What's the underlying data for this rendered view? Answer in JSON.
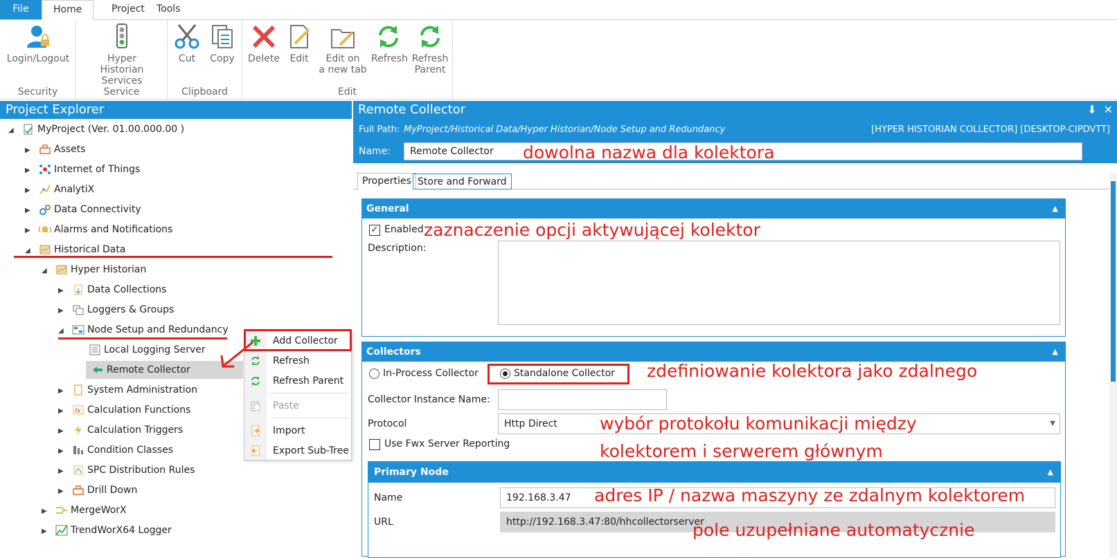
{
  "ribbon": {
    "tabs": {
      "file": "File",
      "home": "Home",
      "project": "Project",
      "tools": "Tools"
    },
    "groups": {
      "security": {
        "label": "Security",
        "login": "Login/Logout"
      },
      "service": {
        "label": "Service",
        "hyper_line1": "Hyper",
        "hyper_line2": "Historian Services"
      },
      "clipboard": {
        "label": "Clipboard",
        "cut": "Cut",
        "copy": "Copy"
      },
      "edit": {
        "label": "Edit",
        "delete": "Delete",
        "edit": "Edit",
        "edit_new_line1": "Edit on",
        "edit_new_line2": "a new tab",
        "refresh": "Refresh",
        "refresh_parent_line1": "Refresh",
        "refresh_parent_line2": "Parent"
      }
    }
  },
  "explorer": {
    "title": "Project Explorer",
    "nodes": [
      {
        "label": "MyProject (Ver. 01.00.000.00 )",
        "icon": "project-icon"
      },
      {
        "label": "Assets",
        "icon": "assets-icon"
      },
      {
        "label": "Internet of Things",
        "icon": "iot-icon"
      },
      {
        "label": "AnalytiX",
        "icon": "analytix-icon"
      },
      {
        "label": "Data Connectivity",
        "icon": "data-connectivity-icon"
      },
      {
        "label": "Alarms and Notifications",
        "icon": "alarm-icon"
      },
      {
        "label": "Historical Data",
        "icon": "historical-data-icon"
      },
      {
        "label": "Hyper Historian",
        "icon": "hyper-historian-icon"
      },
      {
        "label": "Data Collections",
        "icon": "data-collections-icon"
      },
      {
        "label": "Loggers & Groups",
        "icon": "loggers-icon"
      },
      {
        "label": "Node Setup and Redundancy",
        "icon": "node-setup-icon"
      },
      {
        "label": "Local Logging Server",
        "icon": "server-icon"
      },
      {
        "label": "Remote Collector",
        "icon": "remote-collector-icon"
      },
      {
        "label": "System Administration",
        "icon": "system-admin-icon"
      },
      {
        "label": "Calculation Functions",
        "icon": "function-icon"
      },
      {
        "label": "Calculation Triggers",
        "icon": "trigger-icon"
      },
      {
        "label": "Condition Classes",
        "icon": "condition-icon"
      },
      {
        "label": "SPC Distribution Rules",
        "icon": "spc-icon"
      },
      {
        "label": "Drill Down",
        "icon": "drill-down-icon"
      },
      {
        "label": "MergeWorX",
        "icon": "mergeworx-icon"
      },
      {
        "label": "TrendWorX64 Logger",
        "icon": "trendworx-icon"
      }
    ]
  },
  "context_menu": {
    "add_collector": "Add Collector",
    "refresh": "Refresh",
    "refresh_parent": "Refresh Parent",
    "paste": "Paste",
    "import": "Import",
    "export_subtree": "Export Sub-Tree"
  },
  "panel": {
    "title": "Remote Collector",
    "full_path_label": "Full Path:",
    "full_path_value": "MyProject/Historical Data/Hyper Historian/Node Setup and Redundancy",
    "collector_id": "[HYPER HISTORIAN COLLECTOR] [DESKTOP-CIPDVTT]",
    "name_label": "Name:",
    "name_value": "Remote Collector",
    "tabs": {
      "properties": "Properties",
      "store_forward": "Store and Forward"
    },
    "general": {
      "title": "General",
      "enabled_label": "Enabled",
      "enabled": true,
      "description_label": "Description:",
      "description_value": ""
    },
    "collectors": {
      "title": "Collectors",
      "in_process_label": "In-Process Collector",
      "standalone_label": "Standalone Collector",
      "selected": "standalone",
      "instance_label": "Collector Instance Name:",
      "instance_value": "",
      "protocol_label": "Protocol",
      "protocol_value": "Http Direct",
      "fwx_label": "Use Fwx Server Reporting",
      "fwx_checked": false
    },
    "primary_node": {
      "title": "Primary Node",
      "name_label": "Name",
      "name_value": "192.168.3.47",
      "url_label": "URL",
      "url_value": "http://192.168.3.47:80/hhcollectorserver"
    }
  },
  "annotations": {
    "name": "dowolna nazwa dla kolektora",
    "enabled": "zaznaczenie opcji aktywującej kolektor",
    "standalone": "zdefiniowanie kolektora jako zdalnego",
    "protocol_line1": "wybór protokołu komunikacji między",
    "protocol_line2": "kolektorem i serwerem głównym",
    "ip": "adres IP / nazwa maszyny ze zdalnym kolektorem",
    "url": "pole uzupełniane automatycznie"
  },
  "colors": {
    "accent": "#1f8fd6",
    "annotation": "#e0201c",
    "selection": "#d6d6d6"
  }
}
